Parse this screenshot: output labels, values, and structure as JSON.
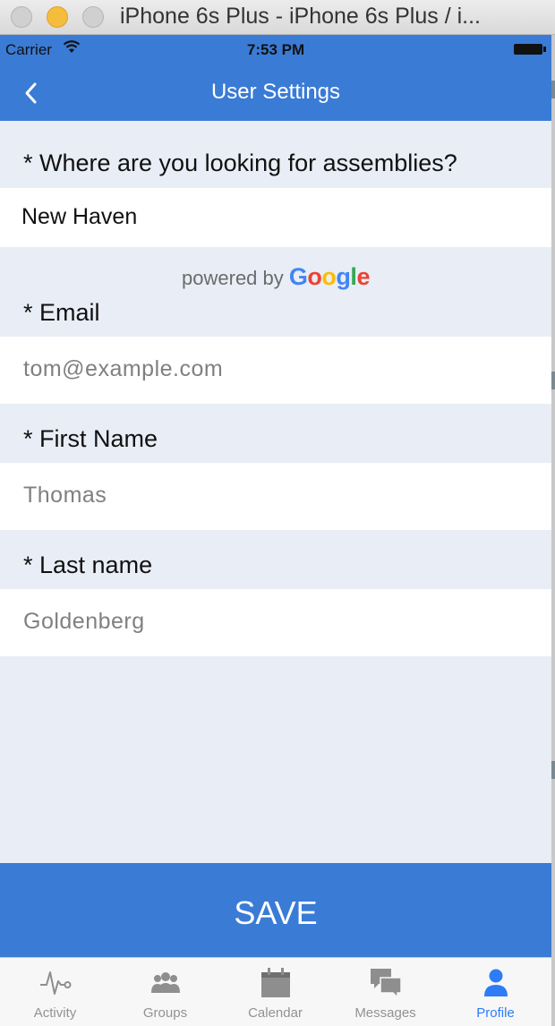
{
  "window": {
    "title": "iPhone 6s Plus - iPhone 6s Plus / i..."
  },
  "status_bar": {
    "carrier": "Carrier",
    "time": "7:53 PM"
  },
  "nav": {
    "title": "User Settings"
  },
  "form": {
    "location": {
      "label": "* Where are you looking for assemblies?",
      "value": "New Haven"
    },
    "powered_by": {
      "text": "powered by",
      "brand": "Google"
    },
    "email": {
      "label": "* Email",
      "placeholder": "tom@example.com"
    },
    "first_name": {
      "label": "* First Name",
      "placeholder": "Thomas"
    },
    "last_name": {
      "label": "* Last name",
      "placeholder": "Goldenberg"
    }
  },
  "save_button": {
    "label": "SAVE"
  },
  "tabs": [
    {
      "label": "Activity",
      "icon": "activity-icon"
    },
    {
      "label": "Groups",
      "icon": "groups-icon"
    },
    {
      "label": "Calendar",
      "icon": "calendar-icon"
    },
    {
      "label": "Messages",
      "icon": "messages-icon"
    },
    {
      "label": "Profile",
      "icon": "profile-icon",
      "active": true
    }
  ],
  "colors": {
    "primary": "#3a7bd5",
    "background": "#e9edf5",
    "tab_active": "#2f7cf6",
    "tab_inactive": "#929292"
  }
}
